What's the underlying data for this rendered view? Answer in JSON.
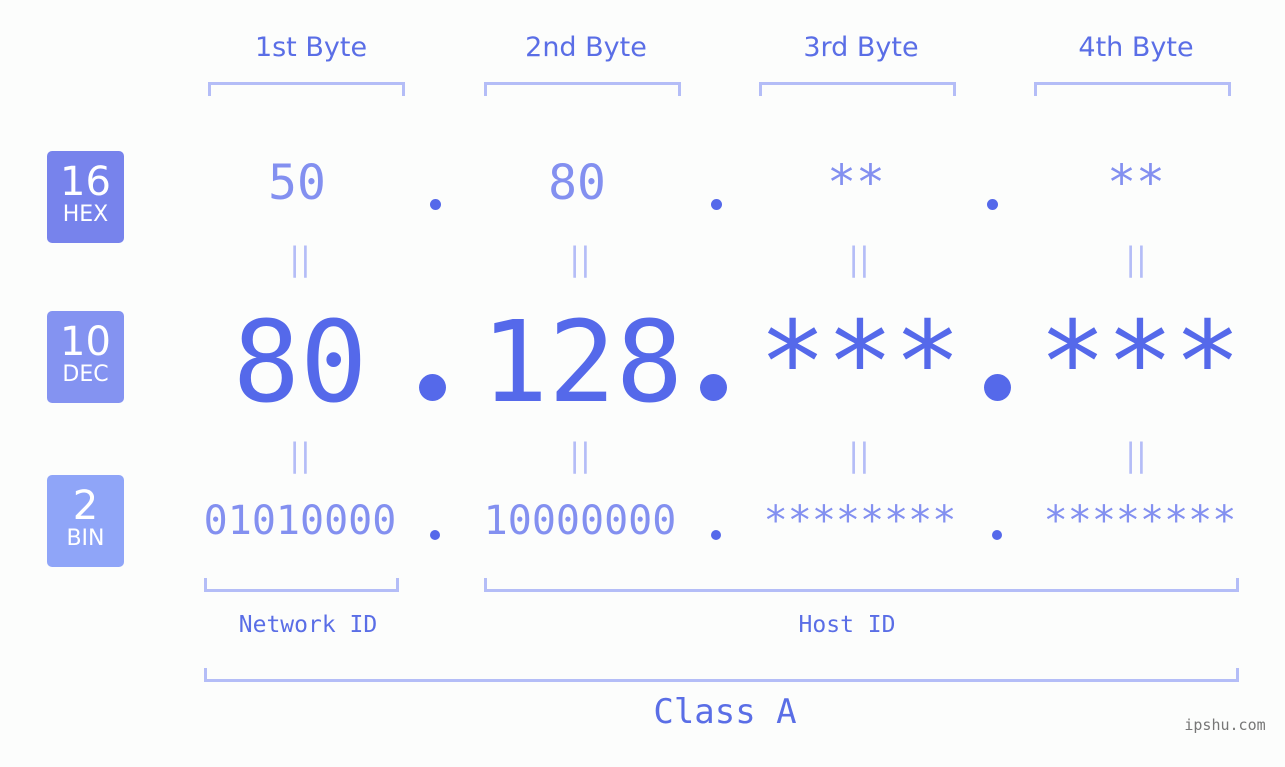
{
  "byte_headers": [
    "1st Byte",
    "2nd Byte",
    "3rd Byte",
    "4th Byte"
  ],
  "rows": {
    "hex": {
      "base": "16",
      "label": "HEX",
      "values": [
        "50",
        "80",
        "**",
        "**"
      ],
      "color": "#7783ec"
    },
    "dec": {
      "base": "10",
      "label": "DEC",
      "values": [
        "80",
        "128",
        "***",
        "***"
      ],
      "color": "#8493f1"
    },
    "bin": {
      "base": "2",
      "label": "BIN",
      "values": [
        "01010000",
        "10000000",
        "********",
        "********"
      ],
      "color": "#8fa5f8"
    }
  },
  "equals_sign": "||",
  "segments": {
    "network_label": "Network ID",
    "host_label": "Host ID"
  },
  "class_label": "Class A",
  "watermark": "ipshu.com",
  "colors": {
    "accent": "#5569ea",
    "light": "#8390f0",
    "bracket": "#b4bdf7"
  }
}
